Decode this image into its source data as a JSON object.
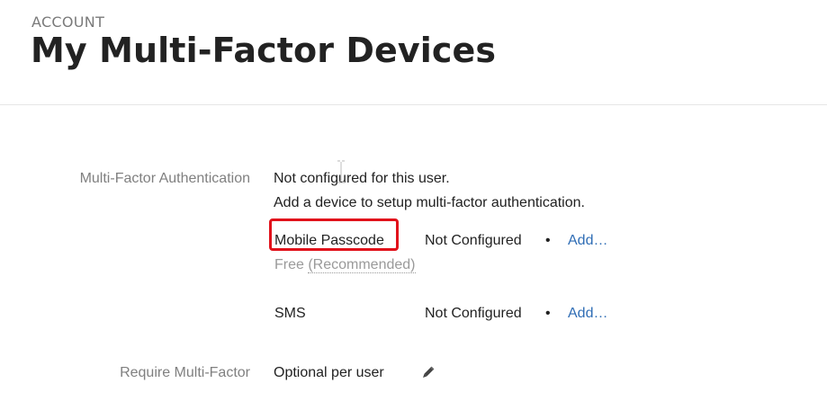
{
  "header": {
    "eyebrow": "ACCOUNT",
    "title": "My Multi-Factor Devices"
  },
  "mfa": {
    "label": "Multi-Factor Authentication",
    "status_line1": "Not configured for this user.",
    "status_line2": "Add a device to setup multi-factor authentication.",
    "devices": [
      {
        "name": "Mobile Passcode",
        "status": "Not Configured",
        "separator": "•",
        "action": "Add…",
        "note_prefix": "Free ",
        "note_recommended": "(Recommended)",
        "highlighted": true
      },
      {
        "name": "SMS",
        "status": "Not Configured",
        "separator": "•",
        "action": "Add…"
      }
    ]
  },
  "require": {
    "label": "Require Multi-Factor",
    "value": "Optional per user",
    "edit_icon": "pencil-icon"
  },
  "colors": {
    "link": "#2f6db5",
    "highlight": "#e1121b",
    "label": "#808080"
  }
}
